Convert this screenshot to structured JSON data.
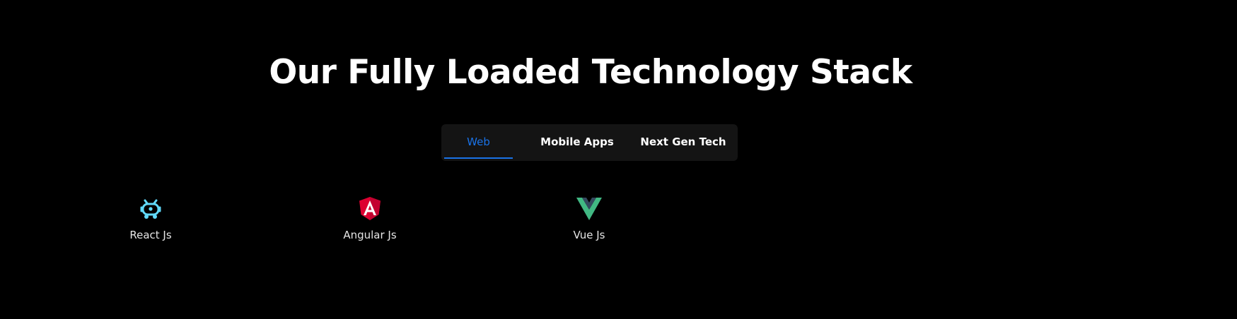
{
  "section": {
    "title": "Our Fully Loaded Technology Stack"
  },
  "tabs": [
    {
      "label": "Web",
      "active": true
    },
    {
      "label": "Mobile Apps",
      "active": false
    },
    {
      "label": "Next Gen Tech",
      "active": false
    }
  ],
  "colors": {
    "background": "#000000",
    "tab_bar": "#141414",
    "active_tab": "#1a73e8",
    "react": "#61dafb",
    "angular": "#dd0031",
    "vue_outer": "#41b883",
    "vue_inner": "#34495e"
  },
  "technologies": [
    {
      "label": "React Js",
      "icon": "react-robot-icon"
    },
    {
      "label": "Angular Js",
      "icon": "angular-icon"
    },
    {
      "label": "Vue Js",
      "icon": "vue-icon"
    }
  ]
}
